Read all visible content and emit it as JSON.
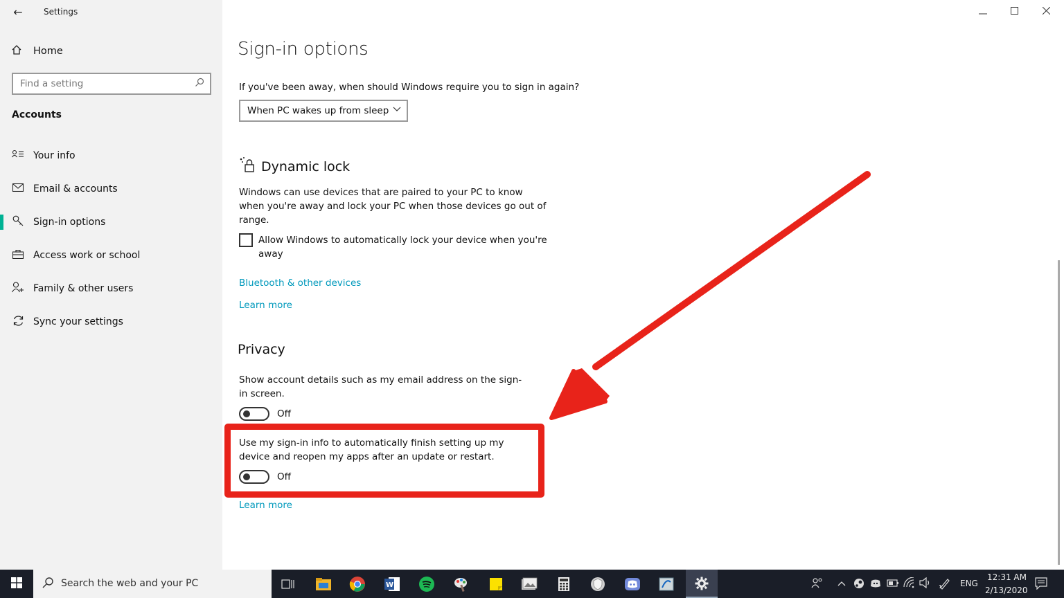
{
  "window": {
    "title": "Settings",
    "controls": {
      "minimize": "—",
      "maximize": "☐",
      "close": "✕"
    }
  },
  "sidebar": {
    "home_label": "Home",
    "search_placeholder": "Find a setting",
    "section_title": "Accounts",
    "items": [
      {
        "label": "Your info",
        "icon": "person-lines-icon",
        "selected": false
      },
      {
        "label": "Email & accounts",
        "icon": "mail-icon",
        "selected": false
      },
      {
        "label": "Sign-in options",
        "icon": "key-icon",
        "selected": true
      },
      {
        "label": "Access work or school",
        "icon": "briefcase-icon",
        "selected": false
      },
      {
        "label": "Family & other users",
        "icon": "person-add-icon",
        "selected": false
      },
      {
        "label": "Sync your settings",
        "icon": "sync-icon",
        "selected": false
      }
    ]
  },
  "main": {
    "title": "Sign-in options",
    "require_signin": {
      "question": "If you've been away, when should Windows require you to sign in again?",
      "selected": "When PC wakes up from sleep"
    },
    "dynamic_lock": {
      "heading": "Dynamic lock",
      "description": "Windows can use devices that are paired to your PC to know when you're away and lock your PC when those devices go out of range.",
      "checkbox_label": "Allow Windows to automatically lock your device when you're away",
      "checked": false,
      "link_bluetooth": "Bluetooth & other devices",
      "link_learn": "Learn more"
    },
    "privacy": {
      "heading": "Privacy",
      "setting1": {
        "text": "Show account details such as my email address on the sign-in screen.",
        "state": "Off"
      },
      "setting2": {
        "text": "Use my sign-in info to automatically finish setting up my device and reopen my apps after an update or restart.",
        "state": "Off"
      },
      "link_learn": "Learn more"
    }
  },
  "annotation": {
    "color": "#e8231a"
  },
  "taskbar": {
    "search_text": "Search the web and your PC",
    "language": "ENG",
    "time": "12:31 AM",
    "date": "2/13/2020"
  },
  "colors": {
    "accent": "#00b294",
    "link": "#0099bc",
    "sidebar_bg": "#f2f2f2",
    "taskbar_bg": "#1a1e28"
  }
}
